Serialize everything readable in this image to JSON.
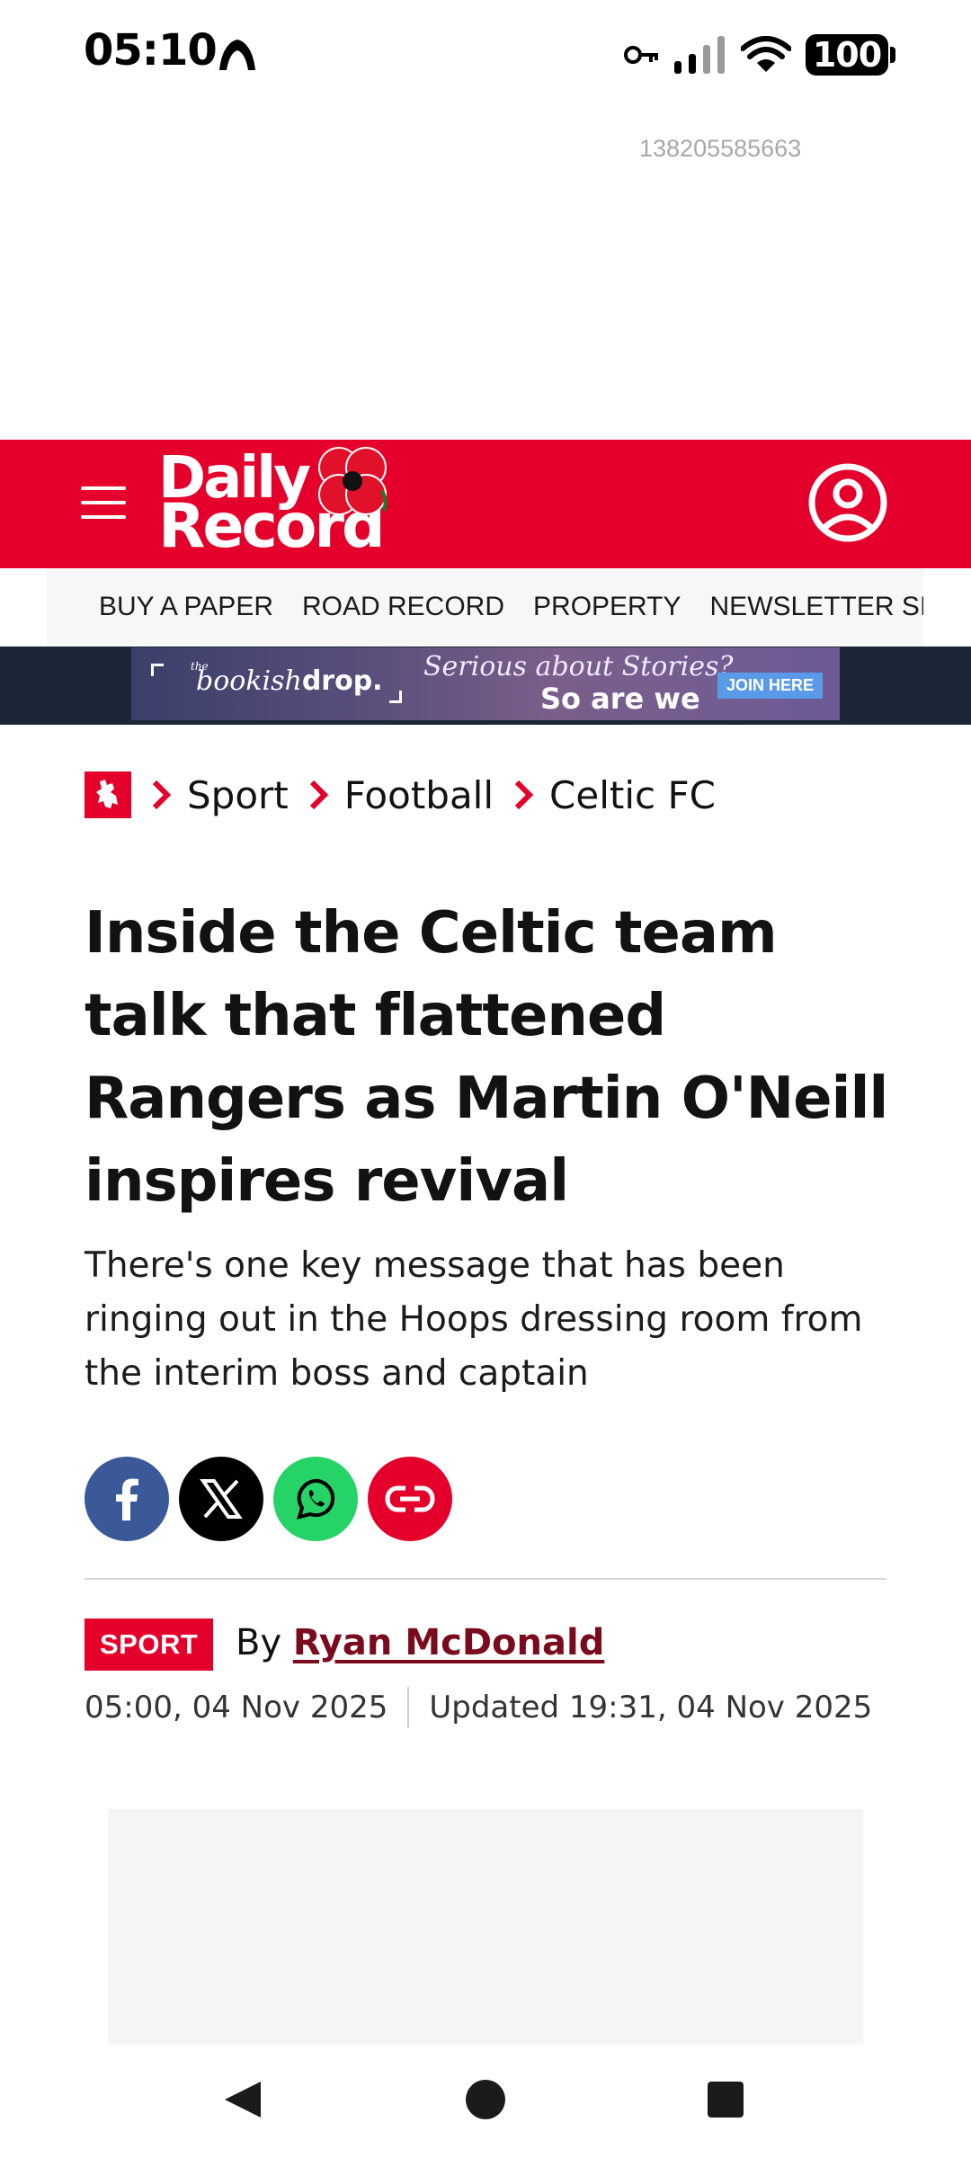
{
  "status_bar": {
    "time": "05:10",
    "battery": "100",
    "icons": [
      "app-notification-icon",
      "vpn-key-icon",
      "signal-icon",
      "wifi-icon",
      "battery-icon"
    ]
  },
  "ad": {
    "slot_id": "138205585663"
  },
  "header": {
    "logo_line1": "Daily",
    "logo_line2": "Record",
    "brand_color": "#e4002b"
  },
  "nav": {
    "links": [
      "BUY A PAPER",
      "ROAD RECORD",
      "PROPERTY",
      "NEWSLETTER SIGNUP"
    ]
  },
  "banner": {
    "brand_prefix": "the",
    "brand_name": "bookish",
    "brand_suffix": "drop.",
    "tagline1": "Serious about Stories?",
    "tagline2": "So are we",
    "cta": "JOIN HERE"
  },
  "breadcrumb": {
    "items": [
      "Sport",
      "Football",
      "Celtic FC"
    ]
  },
  "article": {
    "headline": "Inside the Celtic team talk that flattened Rangers as Martin O'Neill inspires revival",
    "standfirst": "There's one key message that has been ringing out in the Hoops dressing room from the interim boss and captain",
    "section": "SPORT",
    "by": "By",
    "author": "Ryan McDonald",
    "published": "05:00, 04 Nov 2025",
    "updated": "Updated 19:31, 04 Nov 2025"
  },
  "share": {
    "buttons": [
      {
        "name": "facebook",
        "color": "#3b5998"
      },
      {
        "name": "x",
        "color": "#000000"
      },
      {
        "name": "whatsapp",
        "color": "#25d366"
      },
      {
        "name": "copy-link",
        "color": "#e4002b"
      }
    ]
  }
}
